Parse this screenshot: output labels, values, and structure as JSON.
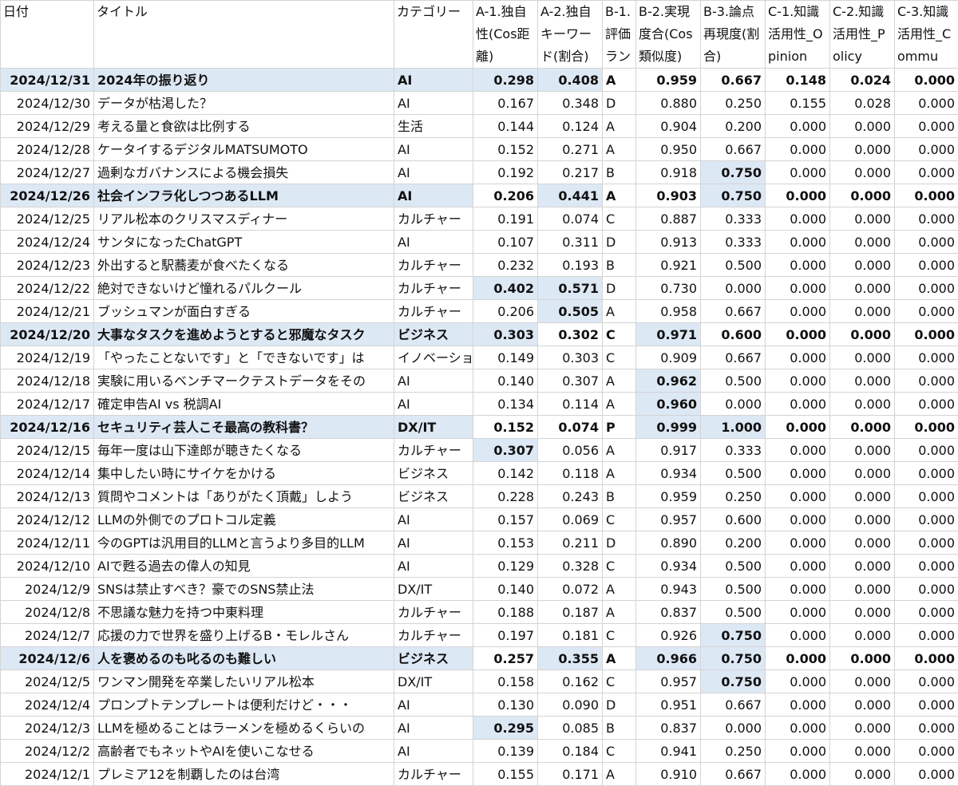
{
  "table": {
    "headers": [
      "日付",
      "タイトル",
      "カテゴリー",
      "A-1.独自性(Cos距離)",
      "A-2.独自キーワード(割合)",
      "B-1.評価ラン",
      "B-2.実現度合(Cos類似度)",
      "B-3.論点再現度(割合)",
      "C-1.知識活用性_Opinion",
      "C-2.知識活用性_Policy",
      "C-3.知識活用性_Commu"
    ],
    "rows": [
      {
        "bold": true,
        "hl": [
          3,
          4
        ],
        "cells": [
          "2024/12/31",
          "2024年の振り返り",
          "AI",
          "0.298",
          "0.408",
          "A",
          "0.959",
          "0.667",
          "0.148",
          "0.024",
          "0.000"
        ]
      },
      {
        "bold": false,
        "hl": [],
        "cells": [
          "2024/12/30",
          "データが枯渇した？",
          "AI",
          "0.167",
          "0.348",
          "D",
          "0.880",
          "0.250",
          "0.155",
          "0.028",
          "0.000"
        ]
      },
      {
        "bold": false,
        "hl": [],
        "cells": [
          "2024/12/29",
          "考える量と食欲は比例する",
          "生活",
          "0.144",
          "0.124",
          "A",
          "0.904",
          "0.200",
          "0.000",
          "0.000",
          "0.000"
        ]
      },
      {
        "bold": false,
        "hl": [],
        "cells": [
          "2024/12/28",
          "ケータイするデジタルMATSUMOTO",
          "AI",
          "0.152",
          "0.271",
          "A",
          "0.950",
          "0.667",
          "0.000",
          "0.000",
          "0.000"
        ]
      },
      {
        "bold": false,
        "hl": [
          7
        ],
        "cells": [
          "2024/12/27",
          "過剰なガバナンスによる機会損失",
          "AI",
          "0.192",
          "0.217",
          "B",
          "0.918",
          "0.750",
          "0.000",
          "0.000",
          "0.000"
        ]
      },
      {
        "bold": true,
        "hl": [
          4,
          7
        ],
        "cells": [
          "2024/12/26",
          "社会インフラ化しつつあるLLM",
          "AI",
          "0.206",
          "0.441",
          "A",
          "0.903",
          "0.750",
          "0.000",
          "0.000",
          "0.000"
        ]
      },
      {
        "bold": false,
        "hl": [],
        "cells": [
          "2024/12/25",
          "リアル松本のクリスマスディナー",
          "カルチャー",
          "0.191",
          "0.074",
          "C",
          "0.887",
          "0.333",
          "0.000",
          "0.000",
          "0.000"
        ]
      },
      {
        "bold": false,
        "hl": [],
        "cells": [
          "2024/12/24",
          "サンタになったChatGPT",
          "AI",
          "0.107",
          "0.311",
          "D",
          "0.913",
          "0.333",
          "0.000",
          "0.000",
          "0.000"
        ]
      },
      {
        "bold": false,
        "hl": [],
        "cells": [
          "2024/12/23",
          "外出すると駅蕎麦が食べたくなる",
          "カルチャー",
          "0.232",
          "0.193",
          "B",
          "0.921",
          "0.500",
          "0.000",
          "0.000",
          "0.000"
        ]
      },
      {
        "bold": false,
        "hl": [
          3,
          4
        ],
        "cells": [
          "2024/12/22",
          "絶対できないけど憧れるパルクール",
          "カルチャー",
          "0.402",
          "0.571",
          "D",
          "0.730",
          "0.000",
          "0.000",
          "0.000",
          "0.000"
        ]
      },
      {
        "bold": false,
        "hl": [
          4
        ],
        "cells": [
          "2024/12/21",
          "ブッシュマンが面白すぎる",
          "カルチャー",
          "0.206",
          "0.505",
          "A",
          "0.958",
          "0.667",
          "0.000",
          "0.000",
          "0.000"
        ]
      },
      {
        "bold": true,
        "hl": [
          3,
          6
        ],
        "cells": [
          "2024/12/20",
          "大事なタスクを進めようとすると邪魔なタスク",
          "ビジネス",
          "0.303",
          "0.302",
          "C",
          "0.971",
          "0.600",
          "0.000",
          "0.000",
          "0.000"
        ]
      },
      {
        "bold": false,
        "hl": [],
        "cells": [
          "2024/12/19",
          "「やったことないです」と「できないです」は",
          "イノベーショ",
          "0.149",
          "0.303",
          "C",
          "0.909",
          "0.667",
          "0.000",
          "0.000",
          "0.000"
        ]
      },
      {
        "bold": false,
        "hl": [
          6
        ],
        "cells": [
          "2024/12/18",
          "実験に用いるベンチマークテストデータをその",
          "AI",
          "0.140",
          "0.307",
          "A",
          "0.962",
          "0.500",
          "0.000",
          "0.000",
          "0.000"
        ]
      },
      {
        "bold": false,
        "hl": [
          6
        ],
        "cells": [
          "2024/12/17",
          "確定申告AI vs 税調AI",
          "AI",
          "0.134",
          "0.114",
          "A",
          "0.960",
          "0.000",
          "0.000",
          "0.000",
          "0.000"
        ]
      },
      {
        "bold": true,
        "hl": [
          6,
          7
        ],
        "cells": [
          "2024/12/16",
          "セキュリティ芸人こそ最高の教科書？",
          "DX/IT",
          "0.152",
          "0.074",
          "P",
          "0.999",
          "1.000",
          "0.000",
          "0.000",
          "0.000"
        ]
      },
      {
        "bold": false,
        "hl": [
          3
        ],
        "cells": [
          "2024/12/15",
          "毎年一度は山下達郎が聴きたくなる",
          "カルチャー",
          "0.307",
          "0.056",
          "A",
          "0.917",
          "0.333",
          "0.000",
          "0.000",
          "0.000"
        ]
      },
      {
        "bold": false,
        "hl": [],
        "cells": [
          "2024/12/14",
          "集中したい時にサイケをかける",
          "ビジネス",
          "0.142",
          "0.118",
          "A",
          "0.934",
          "0.500",
          "0.000",
          "0.000",
          "0.000"
        ]
      },
      {
        "bold": false,
        "hl": [],
        "cells": [
          "2024/12/13",
          "質問やコメントは「ありがたく頂戴」しよう",
          "ビジネス",
          "0.228",
          "0.243",
          "B",
          "0.959",
          "0.250",
          "0.000",
          "0.000",
          "0.000"
        ]
      },
      {
        "bold": false,
        "hl": [],
        "cells": [
          "2024/12/12",
          "LLMの外側でのプロトコル定義",
          "AI",
          "0.157",
          "0.069",
          "C",
          "0.957",
          "0.600",
          "0.000",
          "0.000",
          "0.000"
        ]
      },
      {
        "bold": false,
        "hl": [],
        "cells": [
          "2024/12/11",
          "今のGPTは汎用目的LLMと言うより多目的LLM",
          "AI",
          "0.153",
          "0.211",
          "D",
          "0.890",
          "0.200",
          "0.000",
          "0.000",
          "0.000"
        ]
      },
      {
        "bold": false,
        "hl": [],
        "cells": [
          "2024/12/10",
          "AIで甦る過去の偉人の知見",
          "AI",
          "0.129",
          "0.328",
          "C",
          "0.934",
          "0.500",
          "0.000",
          "0.000",
          "0.000"
        ]
      },
      {
        "bold": false,
        "hl": [],
        "cells": [
          "2024/12/9",
          "SNSは禁止すべき？豪でのSNS禁止法",
          "DX/IT",
          "0.140",
          "0.072",
          "A",
          "0.943",
          "0.500",
          "0.000",
          "0.000",
          "0.000"
        ]
      },
      {
        "bold": false,
        "hl": [],
        "cells": [
          "2024/12/8",
          "不思議な魅力を持つ中東料理",
          "カルチャー",
          "0.188",
          "0.187",
          "A",
          "0.837",
          "0.500",
          "0.000",
          "0.000",
          "0.000"
        ]
      },
      {
        "bold": false,
        "hl": [
          7
        ],
        "cells": [
          "2024/12/7",
          "応援の力で世界を盛り上げるB・モレルさん",
          "カルチャー",
          "0.197",
          "0.181",
          "C",
          "0.926",
          "0.750",
          "0.000",
          "0.000",
          "0.000"
        ]
      },
      {
        "bold": true,
        "hl": [
          4,
          6,
          7
        ],
        "cells": [
          "2024/12/6",
          "人を褒めるのも叱るのも難しい",
          "ビジネス",
          "0.257",
          "0.355",
          "A",
          "0.966",
          "0.750",
          "0.000",
          "0.000",
          "0.000"
        ]
      },
      {
        "bold": false,
        "hl": [
          7
        ],
        "cells": [
          "2024/12/5",
          "ワンマン開発を卒業したいリアル松本",
          "DX/IT",
          "0.158",
          "0.162",
          "C",
          "0.957",
          "0.750",
          "0.000",
          "0.000",
          "0.000"
        ]
      },
      {
        "bold": false,
        "hl": [],
        "cells": [
          "2024/12/4",
          "プロンプトテンプレートは便利だけど・・・",
          "AI",
          "0.130",
          "0.090",
          "D",
          "0.951",
          "0.667",
          "0.000",
          "0.000",
          "0.000"
        ]
      },
      {
        "bold": false,
        "hl": [
          3
        ],
        "cells": [
          "2024/12/3",
          "LLMを極めることはラーメンを極めるくらいの",
          "AI",
          "0.295",
          "0.085",
          "B",
          "0.837",
          "0.000",
          "0.000",
          "0.000",
          "0.000"
        ]
      },
      {
        "bold": false,
        "hl": [],
        "cells": [
          "2024/12/2",
          "高齢者でもネットやAIを使いこなせる",
          "AI",
          "0.139",
          "0.184",
          "C",
          "0.941",
          "0.250",
          "0.000",
          "0.000",
          "0.000"
        ]
      },
      {
        "bold": false,
        "hl": [],
        "cells": [
          "2024/12/1",
          "プレミア12を制覇したのは台湾",
          "カルチャー",
          "0.155",
          "0.171",
          "A",
          "0.910",
          "0.667",
          "0.000",
          "0.000",
          "0.000"
        ]
      }
    ]
  }
}
